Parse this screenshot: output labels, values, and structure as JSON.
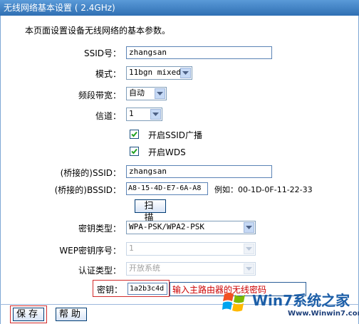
{
  "header": {
    "title": "无线网络基本设置 ( 2.4GHz)"
  },
  "intro": "本页面设置设备无线网络的基本参数。",
  "form": {
    "ssid": {
      "label": "SSID号：",
      "value": "zhangsan"
    },
    "mode": {
      "label": "模式：",
      "value": "11bgn mixed"
    },
    "bandwidth": {
      "label": "频段带宽：",
      "value": "自动"
    },
    "channel": {
      "label": "信道：",
      "value": "1"
    },
    "enable_ssid_broadcast": {
      "label": "开启SSID广播",
      "checked": true
    },
    "enable_wds": {
      "label": "开启WDS",
      "checked": true
    },
    "bridge_ssid": {
      "label": "(桥接的)SSID：",
      "value": "zhangsan"
    },
    "bridge_bssid": {
      "label": "(桥接的)BSSID：",
      "value": "A8-15-4D-E7-6A-A8",
      "example": "例如：00-1D-0F-11-22-33"
    },
    "scan_button": "扫 描",
    "key_type": {
      "label": "密钥类型：",
      "value": "WPA-PSK/WPA2-PSK"
    },
    "wep_index": {
      "label": "WEP密钥序号：",
      "value": "1"
    },
    "auth_type": {
      "label": "认证类型：",
      "value": "开放系统"
    },
    "key": {
      "label": "密钥：",
      "value": "1a2b3c4d",
      "hint": "输入主路由器的无线密码"
    }
  },
  "footer": {
    "save_button": "保存",
    "help_button": "帮助"
  },
  "watermark": {
    "brand": "Win7系统之家",
    "url": "Www.Winwin7.com"
  },
  "colors": {
    "titlebar": "#2f6fb3",
    "hint": "#cc0000",
    "highlight_box": "#d22b2b"
  }
}
